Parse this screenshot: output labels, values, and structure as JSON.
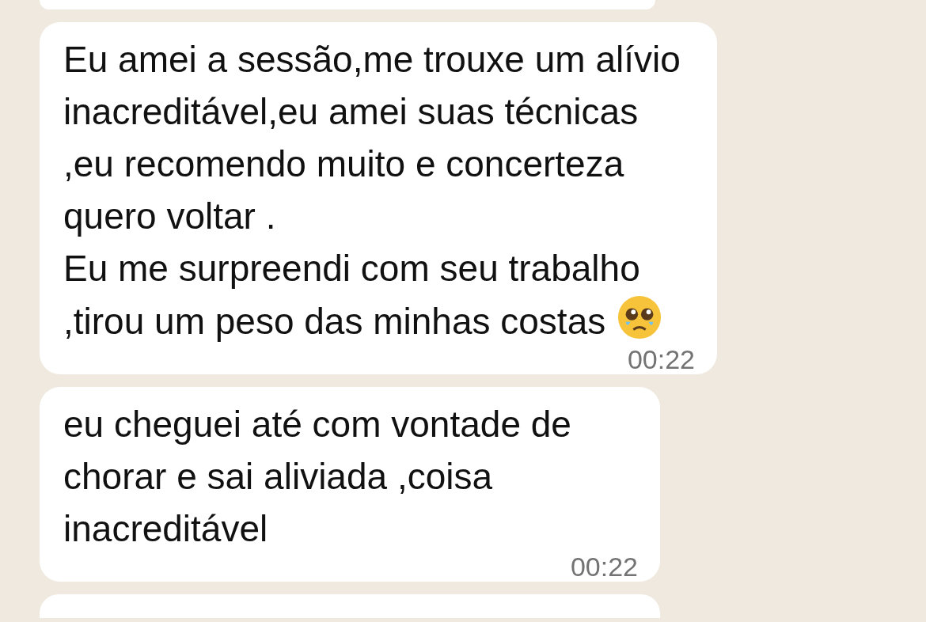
{
  "messages": [
    {
      "text": "Eu amei a sessão,me trouxe um alívio inacreditável,eu amei suas técnicas ,eu recomendo muito e concerteza quero voltar .\nEu me surpreendi com seu trabalho ,tirou um peso das minhas costas",
      "emoji": true,
      "time": "00:22"
    },
    {
      "text": "eu cheguei até com vontade de chorar e sai aliviada ,coisa inacreditável",
      "emoji": false,
      "time": "00:22"
    }
  ]
}
